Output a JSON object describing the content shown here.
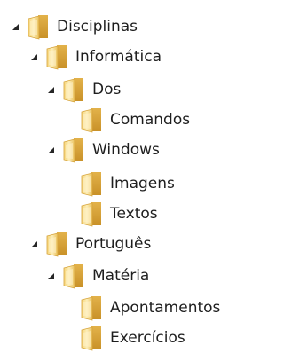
{
  "tree": {
    "disciplinas": {
      "label": "Disciplinas",
      "expanded": true
    },
    "informatica": {
      "label": "Informática",
      "expanded": true
    },
    "dos": {
      "label": "Dos",
      "expanded": true
    },
    "comandos": {
      "label": "Comandos"
    },
    "windows": {
      "label": "Windows",
      "expanded": true
    },
    "imagens": {
      "label": "Imagens"
    },
    "textos": {
      "label": "Textos"
    },
    "portugues": {
      "label": "Português",
      "expanded": true
    },
    "materia": {
      "label": "Matéria",
      "expanded": true
    },
    "apontamentos": {
      "label": "Apontamentos"
    },
    "exercicios": {
      "label": "Exercícios"
    }
  },
  "icons": {
    "expander": "expanded-triangle-icon",
    "folder": "folder-icon"
  },
  "colors": {
    "folder_light": "#fbe6a2",
    "folder_dark": "#d8a93a",
    "expander": "#262626",
    "text": "#1e1e1e"
  }
}
